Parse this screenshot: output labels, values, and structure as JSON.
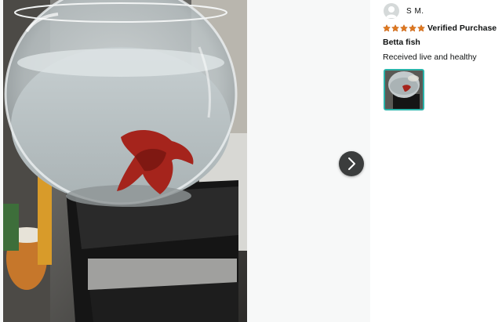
{
  "reviewer": {
    "name": "S M.",
    "avatar_icon": "person-icon"
  },
  "review": {
    "rating": 5,
    "rating_max": 5,
    "star_color": "#de7921",
    "verified_label": "Verified Purchase",
    "title": "Betta fish",
    "body": "Received live and healthy"
  },
  "gallery": {
    "main_image": "photo of a red betta fish in a round glass bowl on a black stand",
    "thumbnail": "betta fish bowl thumbnail",
    "next_icon": "chevron-right-icon",
    "thumb_border_color": "#2ab4aa"
  }
}
